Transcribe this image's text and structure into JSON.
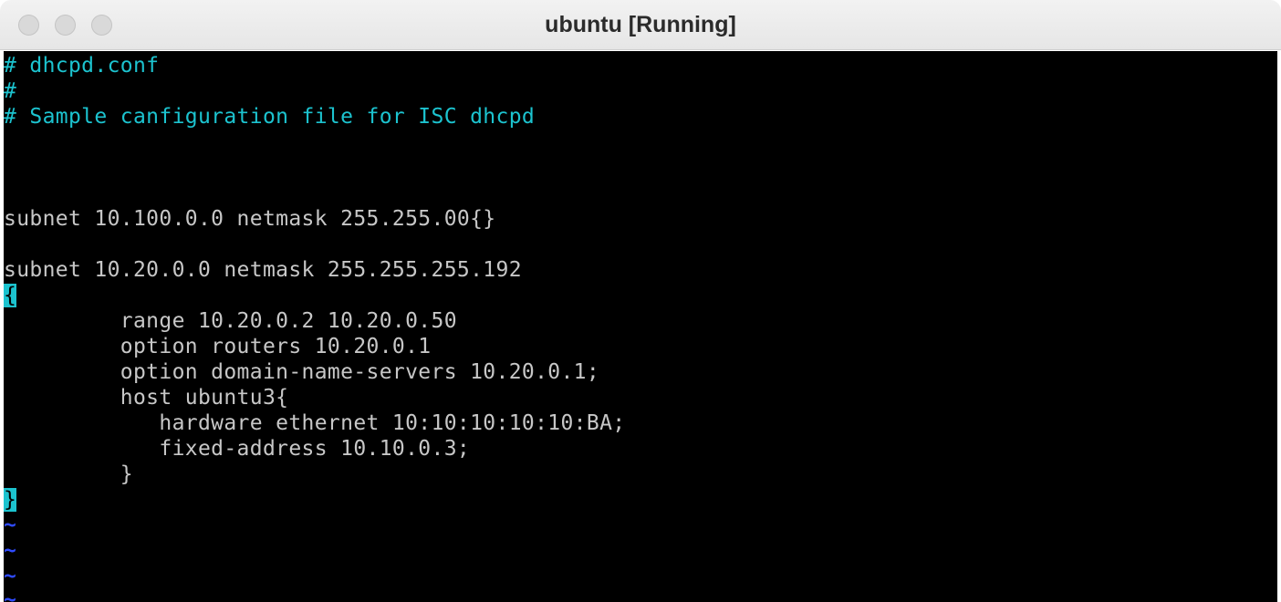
{
  "window": {
    "title": "ubuntu [Running]"
  },
  "colors": {
    "comment": "#1cc3cf",
    "text": "#c7c7c7",
    "background": "#000000",
    "tilde": "#2f4bff",
    "highlight": "#1cc3cf"
  },
  "editor": {
    "lines": [
      "# dhcpd.conf",
      "#",
      "# Sample canfiguration file for ISC dhcpd",
      "",
      "",
      "",
      "subnet 10.100.0.0 netmask 255.255.00{}",
      "",
      "subnet 10.20.0.0 netmask 255.255.255.192",
      "{",
      "         range 10.20.0.2 10.20.0.50",
      "         option routers 10.20.0.1",
      "         option domain-name-servers 10.20.0.1;",
      "         host ubuntu3{",
      "            hardware ethernet 10:10:10:10:10:BA;",
      "            fixed-address 10.10.0.3;",
      "         }",
      "}",
      "~",
      "~",
      "~",
      "~"
    ]
  }
}
